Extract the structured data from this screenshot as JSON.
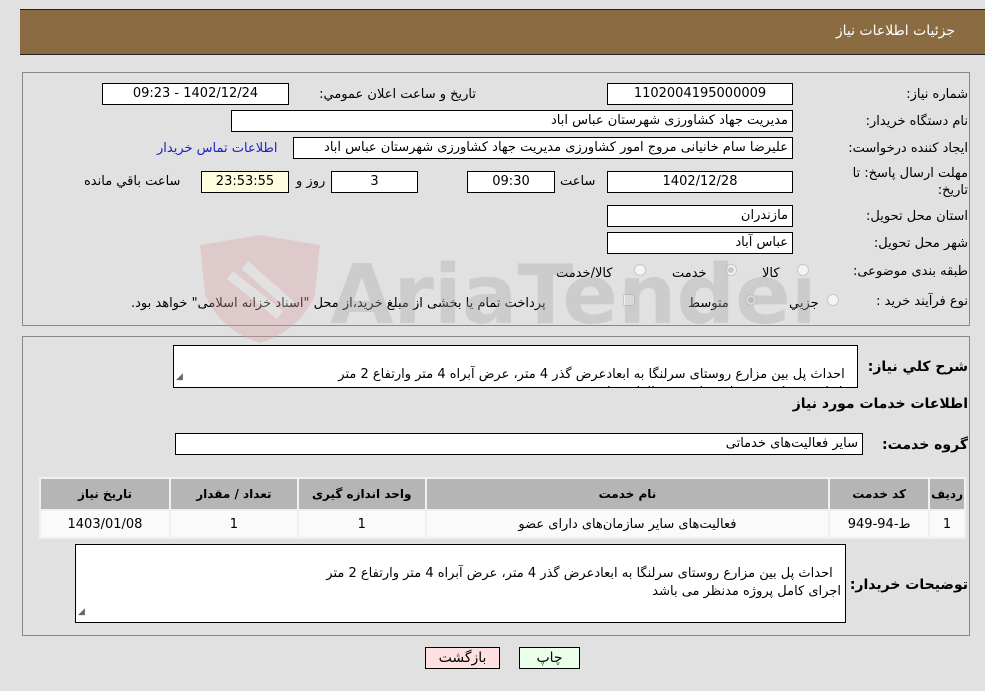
{
  "header": {
    "title": "جزئیات اطلاعات نیاز"
  },
  "details": {
    "need_number_label": "شماره نیاز:",
    "need_number": "1102004195000009",
    "announce_label": "تاریخ و ساعت اعلان عمومي:",
    "announce_value": "1402/12/24 - 09:23",
    "buyer_org_label": "نام دستگاه خريدار:",
    "buyer_org": "مدیریت جهاد کشاورزی شهرستان عباس اباد",
    "creator_label": "ايجاد کننده درخواست:",
    "creator": "علیرضا سام خانیانی مروج امور کشاورزی  مدیریت جهاد کشاورزی شهرستان عباس اباد",
    "contact_link": "اطلاعات تماس خریدار",
    "deadline_label": "مهلت ارسال پاسخ: تا تاریخ:",
    "deadline_date": "1402/12/28",
    "time_label": "ساعت",
    "deadline_time": "09:30",
    "days_value": "3",
    "days_label": "روز و",
    "remaining_time": "23:53:55",
    "remaining_label": "ساعت باقي مانده",
    "province_label": "استان محل تحویل:",
    "province": "مازندران",
    "city_label": "شهر محل تحویل:",
    "city": "عباس آباد",
    "category_label": "طبقه بندی موضوعی:",
    "category_options": [
      {
        "label": "کالا",
        "checked": false
      },
      {
        "label": "خدمت",
        "checked": true
      },
      {
        "label": "کالا/خدمت",
        "checked": false
      }
    ],
    "process_label": "نوع فرآیند خرید :",
    "process_options": [
      {
        "label": "جزيي",
        "checked": false
      },
      {
        "label": "متوسط",
        "checked": true
      }
    ],
    "treasury_note": "پرداخت تمام یا بخشی از مبلغ خرید،از محل \"اسناد خزانه اسلامی\" خواهد بود."
  },
  "summary": {
    "label": "شرح کلي نياز:",
    "text": "احداث پل بین مزارع روستای سرلنگا به ابعادعرض گذر 4 متر، عرض آبراه 4 متر وارتفاع 2 متر\nقبل از پیشنهاد قیمت بازدید از پروژه الزامی باشد.",
    "services_heading": "اطلاعات خدمات مورد نياز",
    "service_group_label": "گروه خدمت:",
    "service_group": "سایر فعالیت‌های خدماتی"
  },
  "table": {
    "headers": [
      "رديف",
      "کد خدمت",
      "نام خدمت",
      "واحد اندازه گيری",
      "تعداد / مقدار",
      "تاريخ نياز"
    ],
    "rows": [
      [
        "1",
        "ط-94-949",
        "فعالیت‌های سایر سازمان‌های دارای عضو",
        "1",
        "1",
        "1403/01/08"
      ]
    ]
  },
  "buyer_notes": {
    "label": "توضيحات خريدار:",
    "text": "احداث پل بین مزارع روستای سرلنگا به ابعادعرض گذر 4 متر، عرض آبراه 4 متر وارتفاع 2 متر\nاجرای کامل پروژه مدنظر می باشد"
  },
  "buttons": {
    "print": "چاپ",
    "back": "بازگشت"
  },
  "watermark": {
    "text": "AriaTender.neT"
  }
}
